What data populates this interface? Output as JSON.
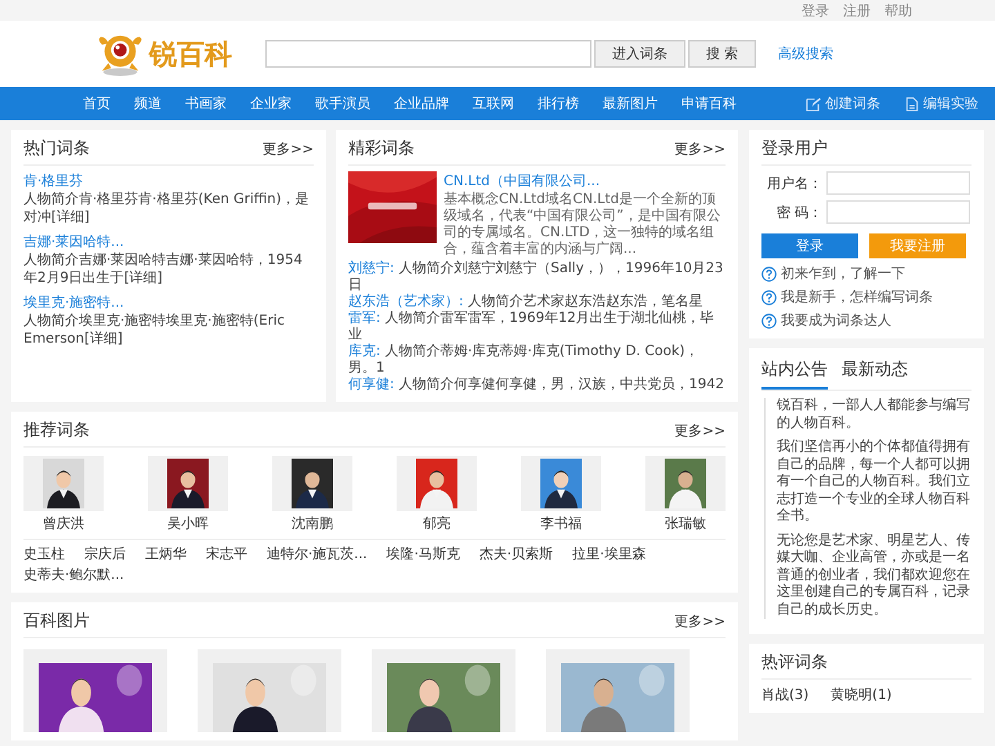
{
  "top_links": [
    "登录",
    "注册",
    "帮助"
  ],
  "logo": {
    "text": "锐百科"
  },
  "search": {
    "buttons": [
      "进入词条",
      "搜 索"
    ],
    "advanced": "高级搜索"
  },
  "nav": {
    "items": [
      "首页",
      "频道",
      "书画家",
      "企业家",
      "歌手演员",
      "企业品牌",
      "互联网",
      "排行榜",
      "最新图片",
      "申请百科"
    ],
    "actions": [
      {
        "kind": "edit",
        "label": "创建词条"
      },
      {
        "kind": "doc",
        "label": "编辑实验"
      }
    ]
  },
  "hot": {
    "title": "热门词条",
    "more": "更多>>",
    "items": [
      {
        "name": "肯·格里芬",
        "summary": "人物简介肯·格里芬肯·格里芬(Ken Griffin)，是对冲[详细]"
      },
      {
        "name": "吉娜·莱因哈特...",
        "summary": "人物简介吉娜·莱因哈特吉娜·莱因哈特，1954年2月9日出生于[详细]"
      },
      {
        "name": "埃里克·施密特...",
        "summary": "人物简介埃里克·施密特埃里克·施密特(Eric Emerson[详细]"
      }
    ]
  },
  "featured": {
    "title": "精彩词条",
    "more": "更多>>",
    "lead": {
      "kind": "picture",
      "title": "CN.Ltd（中国有限公司...",
      "text": "基本概念CN.Ltd域名CN.Ltd是一个全新的顶级域名，代表“中国有限公司”，是中国有限公司的专属域名。CN.LTD，这一独特的域名组合，蕴含着丰富的内涵与广阔..."
    },
    "entries": [
      {
        "name": "刘慈宁:",
        "text": "人物简介刘慈宁刘慈宁（Sally，），1996年10月23日"
      },
      {
        "name": "赵东浩（艺术家）:",
        "text": "人物简介艺术家赵东浩赵东浩，笔名星"
      },
      {
        "name": "雷军:",
        "text": "人物简介雷军雷军，1969年12月出生于湖北仙桃，毕业"
      },
      {
        "name": "库克:",
        "text": "人物简介蒂姆·库克蒂姆·库克(Timothy D. Cook)，男。1"
      },
      {
        "name": "何享健:",
        "text": "人物简介何享健何享健，男，汉族，中共党员，1942"
      }
    ]
  },
  "login": {
    "title": "登录用户",
    "fields": [
      {
        "label": "用户名："
      },
      {
        "label": "密 码："
      }
    ],
    "buttons": [
      {
        "kind": "primary",
        "label": "登录"
      },
      {
        "kind": "accent",
        "label": "我要注册"
      }
    ],
    "help": [
      "初来乍到，了解一下",
      "我是新手，怎样编写词条",
      "我要成为词条达人"
    ]
  },
  "recommended": {
    "title": "推荐词条",
    "more": "更多>>",
    "people": [
      {
        "name": "曾庆洪",
        "kind": "picture"
      },
      {
        "name": "吴小晖",
        "kind": "picture"
      },
      {
        "name": "沈南鹏",
        "kind": "picture"
      },
      {
        "name": "郁亮",
        "kind": "picture"
      },
      {
        "name": "李书福",
        "kind": "picture"
      },
      {
        "name": "张瑞敏",
        "kind": "picture"
      }
    ],
    "names": [
      "史玉柱",
      "宗庆后",
      "王炳华",
      "宋志平",
      "迪特尔·施瓦茨...",
      "埃隆·马斯克",
      "杰夫·贝索斯",
      "拉里·埃里森",
      "史蒂夫·鲍尔默..."
    ]
  },
  "notice": {
    "tabs": [
      {
        "label": "站内公告",
        "selected": true
      },
      {
        "label": "最新动态",
        "selected": false
      }
    ],
    "paragraphs": [
      "锐百科，一部人人都能参与编写的人物百科。",
      "我们坚信再小的个体都值得拥有自己的品牌，每一个人都可以拥有一个自己的人物百科。我们立志打造一个专业的全球人物百科全书。",
      "无论您是艺术家、明星艺人、传媒大咖、企业高管，亦或是一名普通的创业者，我们都欢迎您在这里创建自己的专属百科，记录自己的成长历史。"
    ]
  },
  "pictures": {
    "title": "百科图片",
    "more": "更多>>"
  },
  "hot_comments": {
    "title": "热评词条",
    "items": [
      "肖战(3)",
      "黄晓明(1)"
    ]
  }
}
